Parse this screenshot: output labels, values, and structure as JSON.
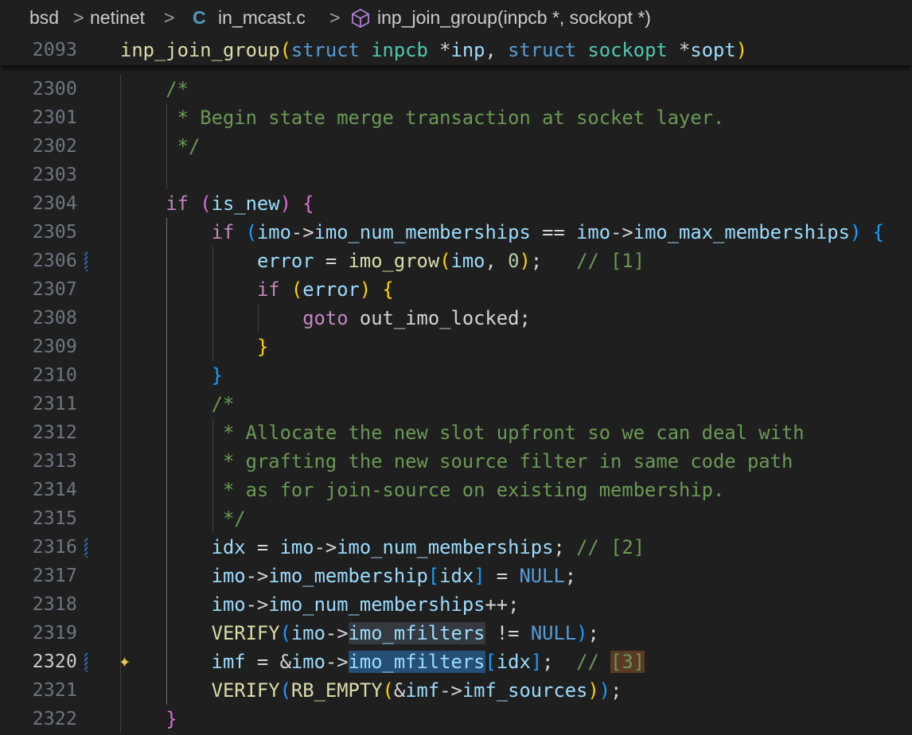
{
  "breadcrumb": {
    "items": [
      "bsd",
      "netinet",
      "in_mcast.c",
      "inp_join_group(inpcb *, sockopt *)"
    ],
    "separator": ">",
    "file_icon_glyph": "C",
    "file_icon_name": "c-file-icon",
    "symbol_icon_name": "cube-method-icon"
  },
  "sticky": {
    "line_number": "2093",
    "text": "inp_join_group(struct inpcb *inp, struct sockopt *sopt)"
  },
  "editor": {
    "active_line": "2320",
    "modified_lines": [
      "2306",
      "2316",
      "2320"
    ],
    "lines": [
      {
        "n": "2300",
        "text": "    /*"
      },
      {
        "n": "2301",
        "text": "     * Begin state merge transaction at socket layer."
      },
      {
        "n": "2302",
        "text": "     */"
      },
      {
        "n": "2303",
        "text": ""
      },
      {
        "n": "2304",
        "text": "    if (is_new) {"
      },
      {
        "n": "2305",
        "text": "        if (imo->imo_num_memberships == imo->imo_max_memberships) {"
      },
      {
        "n": "2306",
        "text": "            error = imo_grow(imo, 0);   // [1]"
      },
      {
        "n": "2307",
        "text": "            if (error) {"
      },
      {
        "n": "2308",
        "text": "                goto out_imo_locked;"
      },
      {
        "n": "2309",
        "text": "            }"
      },
      {
        "n": "2310",
        "text": "        }"
      },
      {
        "n": "2311",
        "text": "        /*"
      },
      {
        "n": "2312",
        "text": "         * Allocate the new slot upfront so we can deal with"
      },
      {
        "n": "2313",
        "text": "         * grafting the new source filter in same code path"
      },
      {
        "n": "2314",
        "text": "         * as for join-source on existing membership."
      },
      {
        "n": "2315",
        "text": "         */"
      },
      {
        "n": "2316",
        "text": "        idx = imo->imo_num_memberships; // [2]"
      },
      {
        "n": "2317",
        "text": "        imo->imo_membership[idx] = NULL;"
      },
      {
        "n": "2318",
        "text": "        imo->imo_num_memberships++;"
      },
      {
        "n": "2319",
        "text": "        VERIFY(imo->imo_mfilters != NULL);"
      },
      {
        "n": "2320",
        "text": "        imf = &imo->imo_mfilters[idx];  // [3]"
      },
      {
        "n": "2321",
        "text": "        VERIFY(RB_EMPTY(&imf->imf_sources));"
      },
      {
        "n": "2322",
        "text": "    }"
      }
    ]
  },
  "colors": {
    "background": "#1f1f1f",
    "keyword": "#569cd6",
    "type": "#4ec9b0",
    "function": "#dcdcaa",
    "variable": "#9cdcfe",
    "comment": "#6a9955",
    "control": "#c586c0",
    "number": "#b5cea8",
    "bracket_1": "#ffd700",
    "bracket_2": "#da70d6",
    "bracket_3": "#179fff",
    "selection": "#264f78",
    "word_highlight": "#343a40",
    "modified_gutter": "#2f6fb5"
  }
}
